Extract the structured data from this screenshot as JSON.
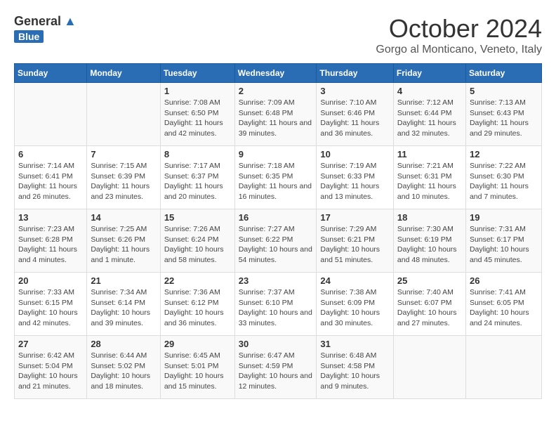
{
  "header": {
    "logo_general": "General",
    "logo_blue": "Blue",
    "month": "October 2024",
    "location": "Gorgo al Monticano, Veneto, Italy"
  },
  "days_of_week": [
    "Sunday",
    "Monday",
    "Tuesday",
    "Wednesday",
    "Thursday",
    "Friday",
    "Saturday"
  ],
  "weeks": [
    [
      {
        "day": "",
        "info": ""
      },
      {
        "day": "",
        "info": ""
      },
      {
        "day": "1",
        "info": "Sunrise: 7:08 AM\nSunset: 6:50 PM\nDaylight: 11 hours and 42 minutes."
      },
      {
        "day": "2",
        "info": "Sunrise: 7:09 AM\nSunset: 6:48 PM\nDaylight: 11 hours and 39 minutes."
      },
      {
        "day": "3",
        "info": "Sunrise: 7:10 AM\nSunset: 6:46 PM\nDaylight: 11 hours and 36 minutes."
      },
      {
        "day": "4",
        "info": "Sunrise: 7:12 AM\nSunset: 6:44 PM\nDaylight: 11 hours and 32 minutes."
      },
      {
        "day": "5",
        "info": "Sunrise: 7:13 AM\nSunset: 6:43 PM\nDaylight: 11 hours and 29 minutes."
      }
    ],
    [
      {
        "day": "6",
        "info": "Sunrise: 7:14 AM\nSunset: 6:41 PM\nDaylight: 11 hours and 26 minutes."
      },
      {
        "day": "7",
        "info": "Sunrise: 7:15 AM\nSunset: 6:39 PM\nDaylight: 11 hours and 23 minutes."
      },
      {
        "day": "8",
        "info": "Sunrise: 7:17 AM\nSunset: 6:37 PM\nDaylight: 11 hours and 20 minutes."
      },
      {
        "day": "9",
        "info": "Sunrise: 7:18 AM\nSunset: 6:35 PM\nDaylight: 11 hours and 16 minutes."
      },
      {
        "day": "10",
        "info": "Sunrise: 7:19 AM\nSunset: 6:33 PM\nDaylight: 11 hours and 13 minutes."
      },
      {
        "day": "11",
        "info": "Sunrise: 7:21 AM\nSunset: 6:31 PM\nDaylight: 11 hours and 10 minutes."
      },
      {
        "day": "12",
        "info": "Sunrise: 7:22 AM\nSunset: 6:30 PM\nDaylight: 11 hours and 7 minutes."
      }
    ],
    [
      {
        "day": "13",
        "info": "Sunrise: 7:23 AM\nSunset: 6:28 PM\nDaylight: 11 hours and 4 minutes."
      },
      {
        "day": "14",
        "info": "Sunrise: 7:25 AM\nSunset: 6:26 PM\nDaylight: 11 hours and 1 minute."
      },
      {
        "day": "15",
        "info": "Sunrise: 7:26 AM\nSunset: 6:24 PM\nDaylight: 10 hours and 58 minutes."
      },
      {
        "day": "16",
        "info": "Sunrise: 7:27 AM\nSunset: 6:22 PM\nDaylight: 10 hours and 54 minutes."
      },
      {
        "day": "17",
        "info": "Sunrise: 7:29 AM\nSunset: 6:21 PM\nDaylight: 10 hours and 51 minutes."
      },
      {
        "day": "18",
        "info": "Sunrise: 7:30 AM\nSunset: 6:19 PM\nDaylight: 10 hours and 48 minutes."
      },
      {
        "day": "19",
        "info": "Sunrise: 7:31 AM\nSunset: 6:17 PM\nDaylight: 10 hours and 45 minutes."
      }
    ],
    [
      {
        "day": "20",
        "info": "Sunrise: 7:33 AM\nSunset: 6:15 PM\nDaylight: 10 hours and 42 minutes."
      },
      {
        "day": "21",
        "info": "Sunrise: 7:34 AM\nSunset: 6:14 PM\nDaylight: 10 hours and 39 minutes."
      },
      {
        "day": "22",
        "info": "Sunrise: 7:36 AM\nSunset: 6:12 PM\nDaylight: 10 hours and 36 minutes."
      },
      {
        "day": "23",
        "info": "Sunrise: 7:37 AM\nSunset: 6:10 PM\nDaylight: 10 hours and 33 minutes."
      },
      {
        "day": "24",
        "info": "Sunrise: 7:38 AM\nSunset: 6:09 PM\nDaylight: 10 hours and 30 minutes."
      },
      {
        "day": "25",
        "info": "Sunrise: 7:40 AM\nSunset: 6:07 PM\nDaylight: 10 hours and 27 minutes."
      },
      {
        "day": "26",
        "info": "Sunrise: 7:41 AM\nSunset: 6:05 PM\nDaylight: 10 hours and 24 minutes."
      }
    ],
    [
      {
        "day": "27",
        "info": "Sunrise: 6:42 AM\nSunset: 5:04 PM\nDaylight: 10 hours and 21 minutes."
      },
      {
        "day": "28",
        "info": "Sunrise: 6:44 AM\nSunset: 5:02 PM\nDaylight: 10 hours and 18 minutes."
      },
      {
        "day": "29",
        "info": "Sunrise: 6:45 AM\nSunset: 5:01 PM\nDaylight: 10 hours and 15 minutes."
      },
      {
        "day": "30",
        "info": "Sunrise: 6:47 AM\nSunset: 4:59 PM\nDaylight: 10 hours and 12 minutes."
      },
      {
        "day": "31",
        "info": "Sunrise: 6:48 AM\nSunset: 4:58 PM\nDaylight: 10 hours and 9 minutes."
      },
      {
        "day": "",
        "info": ""
      },
      {
        "day": "",
        "info": ""
      }
    ]
  ]
}
